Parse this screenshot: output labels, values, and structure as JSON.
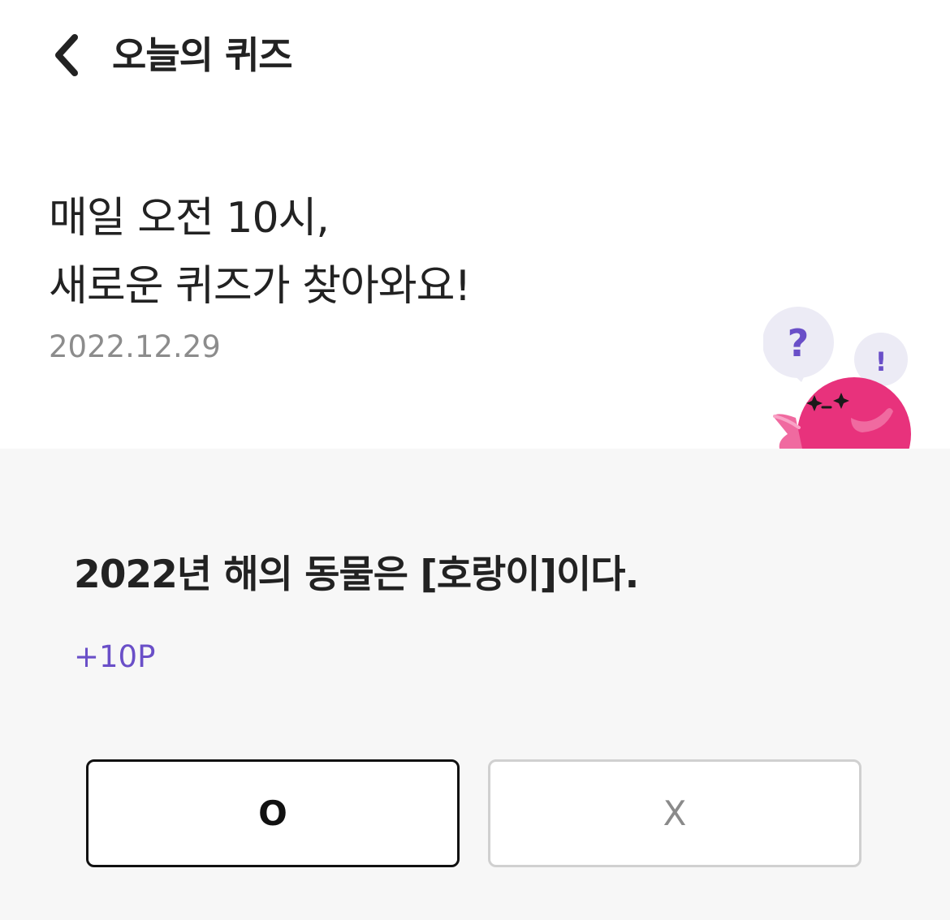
{
  "header": {
    "title": "오늘의 퀴즈",
    "back_icon": "chevron-left-icon"
  },
  "intro": {
    "line1": "매일 오전 10시,",
    "line2": "새로운 퀴즈가 찾아와요!",
    "date": "2022.12.29",
    "mascot": {
      "question_mark": "?",
      "exclamation_mark": "!",
      "body_color": "#e8327c",
      "bubble_color": "#ecebf5",
      "mark_color": "#6a4fc8"
    }
  },
  "quiz": {
    "question": "2022년 해의 동물은 [호랑이]이다.",
    "points": "+10P",
    "answers": {
      "o_label": "O",
      "x_label": "X"
    }
  },
  "colors": {
    "accent": "#6a4fc8",
    "text": "#222222",
    "muted": "#8c8c8c",
    "quiz_bg": "#f7f7f7"
  }
}
